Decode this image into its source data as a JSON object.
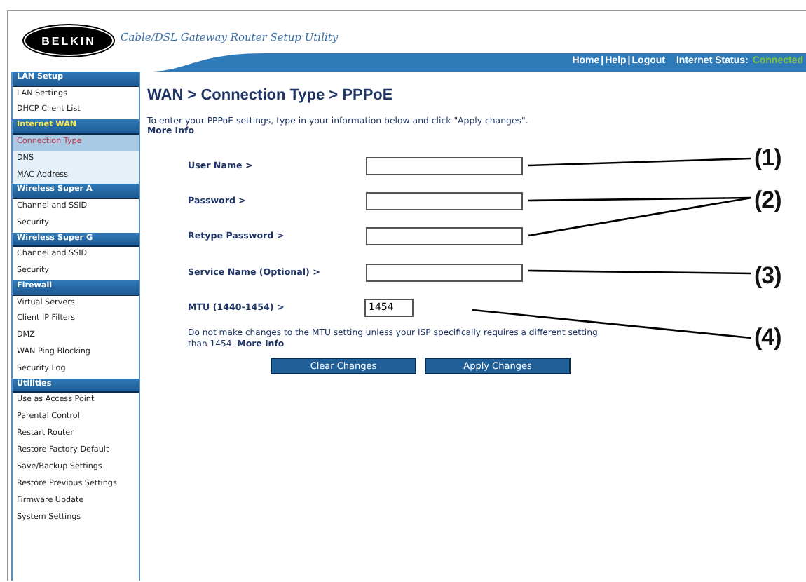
{
  "header": {
    "logo": "BELKIN",
    "title": "Cable/DSL Gateway Router Setup Utility",
    "nav": [
      {
        "label": "Home"
      },
      {
        "label": "Help"
      },
      {
        "label": "Logout"
      }
    ],
    "separator": "|",
    "status_label": "Internet Status:",
    "status": "Connected",
    "connected": true
  },
  "sidebar": [
    {
      "title": "LAN Setup",
      "selected": false,
      "items": [
        {
          "label": "LAN Settings",
          "selected": false
        },
        {
          "label": "DHCP Client List",
          "selected": false
        }
      ]
    },
    {
      "title": "Internet WAN",
      "selected": true,
      "items": [
        {
          "label": "Connection Type",
          "selected": true
        },
        {
          "label": "DNS",
          "selected": false
        },
        {
          "label": "MAC Address",
          "selected": false
        }
      ]
    },
    {
      "title": "Wireless Super A",
      "selected": false,
      "items": [
        {
          "label": "Channel and SSID",
          "selected": false
        },
        {
          "label": "Security",
          "selected": false
        }
      ]
    },
    {
      "title": "Wireless Super G",
      "selected": false,
      "items": [
        {
          "label": "Channel and SSID",
          "selected": false
        },
        {
          "label": "Security",
          "selected": false
        }
      ]
    },
    {
      "title": "Firewall",
      "selected": false,
      "items": [
        {
          "label": "Virtual Servers",
          "selected": false
        },
        {
          "label": "Client IP Filters",
          "selected": false
        },
        {
          "label": "DMZ",
          "selected": false
        },
        {
          "label": "WAN Ping Blocking",
          "selected": false
        },
        {
          "label": "Security Log",
          "selected": false
        }
      ]
    },
    {
      "title": "Utilities",
      "selected": false,
      "items": [
        {
          "label": "Use as Access Point",
          "selected": false
        },
        {
          "label": "Parental Control",
          "selected": false
        },
        {
          "label": "Restart Router",
          "selected": false
        },
        {
          "label": "Restore Factory Default",
          "selected": false
        },
        {
          "label": "Save/Backup Settings",
          "selected": false
        },
        {
          "label": "Restore Previous Settings",
          "selected": false
        },
        {
          "label": "Firmware Update",
          "selected": false
        },
        {
          "label": "System Settings",
          "selected": false
        }
      ]
    }
  ],
  "main": {
    "title": "WAN > Connection Type > PPPoE",
    "intro": "To enter your PPPoE settings, type in your information below and click \"Apply changes\".",
    "intro_link": "More Info",
    "fields": [
      {
        "label": "User Name >"
      },
      {
        "label": "Password >"
      },
      {
        "label": "Retype Password >"
      },
      {
        "label": "Service Name (Optional) >"
      },
      {
        "label": "MTU (1440-1454) >",
        "value": "1454",
        "kind": "short"
      }
    ],
    "note": "Do not make changes to the MTU setting unless your ISP specifically requires a different setting than 1454.",
    "note_link": "More Info",
    "buttons": [
      "Clear Changes",
      "Apply Changes"
    ]
  },
  "callouts": [
    {
      "label": "(1)"
    },
    {
      "label": "(2)"
    },
    {
      "label": "(3)"
    },
    {
      "label": "(4)"
    }
  ]
}
